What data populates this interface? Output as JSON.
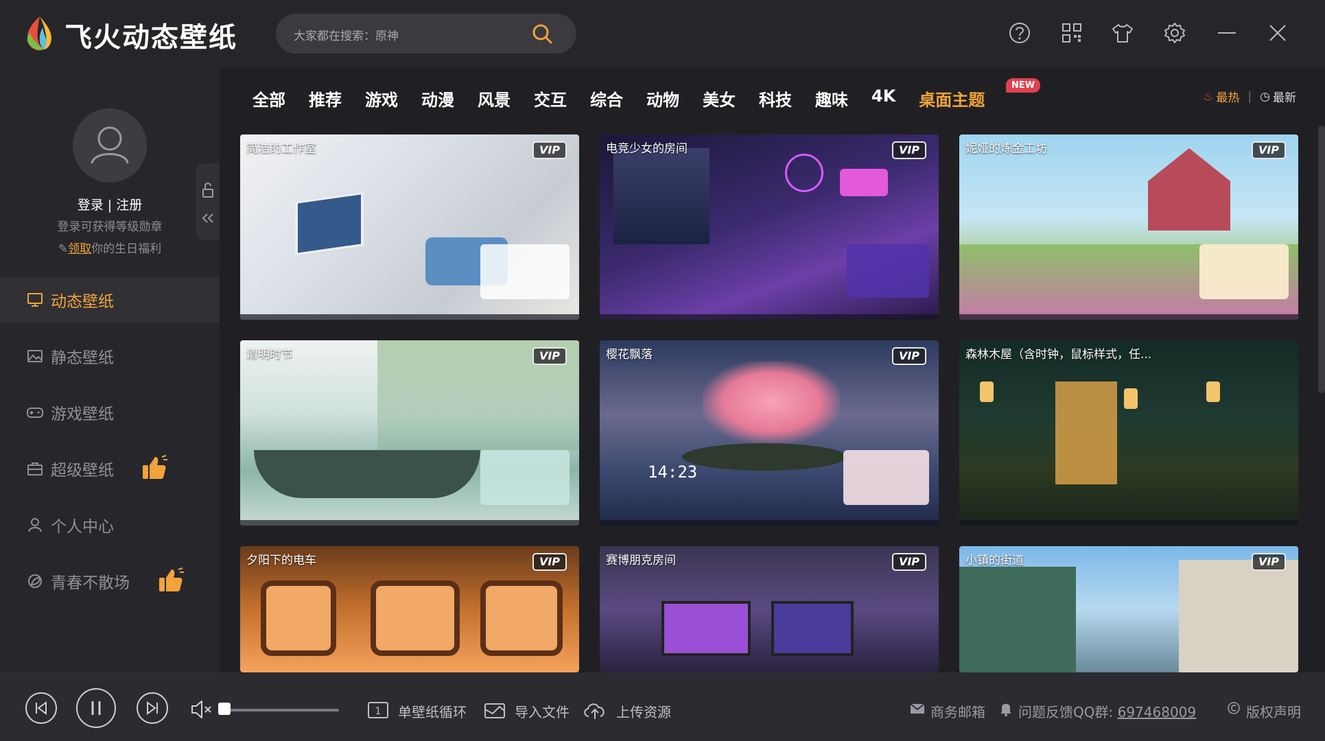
{
  "app": {
    "title": "飞火动态壁纸"
  },
  "search": {
    "placeholder": "大家都在搜索：原神"
  },
  "user": {
    "login_label": "登录 | 注册",
    "level_hint": "登录可获得等级勋章",
    "birthday_link": "领取",
    "birthday_text": "你的生日福利"
  },
  "nav": [
    {
      "label": "动态壁纸",
      "icon": "monitor-icon",
      "active": true
    },
    {
      "label": "静态壁纸",
      "icon": "image-icon",
      "active": false
    },
    {
      "label": "游戏壁纸",
      "icon": "gamepad-icon",
      "active": false
    },
    {
      "label": "超级壁纸",
      "icon": "briefcase-icon",
      "active": false,
      "badge": "thumbs-up-icon"
    },
    {
      "label": "个人中心",
      "icon": "user-icon",
      "active": false
    },
    {
      "label": "青春不散场",
      "icon": "leaf-icon",
      "active": false,
      "badge": "thumbs-up-icon"
    }
  ],
  "categories": [
    "全部",
    "推荐",
    "游戏",
    "动漫",
    "风景",
    "交互",
    "综合",
    "动物",
    "美女",
    "科技",
    "趣味",
    "4K",
    "桌面主题"
  ],
  "new_badge": "NEW",
  "sort": {
    "hot": "最热",
    "latest": "最新"
  },
  "vip_label": "VIP",
  "wallpapers": [
    {
      "title": "简洁的工作室",
      "vip": true
    },
    {
      "title": "电竞少女的房间",
      "vip": true
    },
    {
      "title": "妮娅的炼金工坊",
      "vip": true
    },
    {
      "title": "清明时节",
      "vip": true,
      "clock": ""
    },
    {
      "title": "樱花飘落",
      "vip": true,
      "clock": "14:23"
    },
    {
      "title": "森林木屋（含时钟，鼠标样式，任...",
      "vip": false
    },
    {
      "title": "夕阳下的电车",
      "vip": true
    },
    {
      "title": "赛博朋克房间",
      "vip": true
    },
    {
      "title": "小镇的街道",
      "vip": true
    }
  ],
  "player": {
    "loop_label": "单壁纸循环",
    "import_label": "导入文件",
    "upload_label": "上传资源",
    "volume": 0.0
  },
  "footer": {
    "email_label": "商务邮箱",
    "feedback_label": "问题反馈QQ群:",
    "qq_group": "697468009",
    "copyright_label": "版权声明"
  },
  "colors": {
    "accent": "#f2a33a",
    "bg": "#26262a",
    "badge": "#e0404f"
  }
}
